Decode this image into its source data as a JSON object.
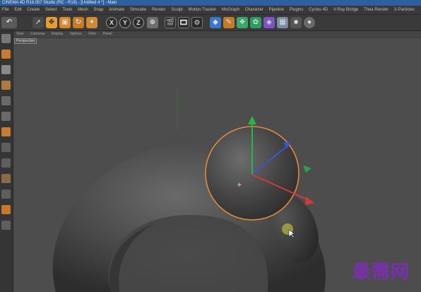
{
  "window": {
    "title": "CINEMA 4D R18.057 Studio (RC - R18) - [Untitled 4 *] - Main"
  },
  "menubar": {
    "items": [
      "File",
      "Edit",
      "Create",
      "Select",
      "Tools",
      "Mesh",
      "Snap",
      "Animate",
      "Simulate",
      "Render",
      "Sculpt",
      "Motion Tracker",
      "MoGraph",
      "Character",
      "Pipeline",
      "Plugins",
      "Cycles 4D",
      "V-Ray Bridge",
      "Thea Render",
      "X-Particles"
    ]
  },
  "toolbar": {
    "axis_labels": [
      "X",
      "Y",
      "Z"
    ]
  },
  "viewport": {
    "menu": [
      "View",
      "Cameras",
      "Display",
      "Options",
      "Filter",
      "Panel"
    ],
    "label": "Perspective"
  },
  "watermark": "最需网",
  "colors": {
    "accent_title": "#2e5fa0",
    "selection_outline": "#e38a3a",
    "axis_x": "#d23a3a",
    "axis_y": "#2eb34a",
    "axis_z": "#3a56d6",
    "watermark": "#7a2fb0"
  }
}
